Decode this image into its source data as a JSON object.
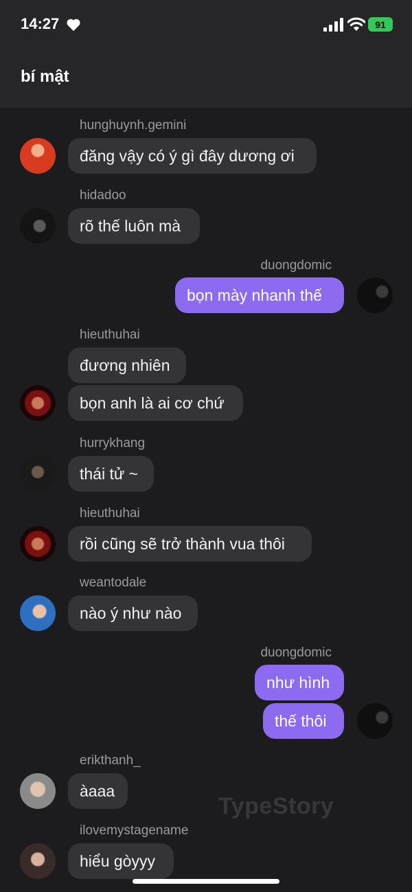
{
  "status": {
    "time": "14:27",
    "battery": "91"
  },
  "header": {
    "title": "bí mật"
  },
  "watermark": "TypeStory",
  "messages": [
    {
      "sender": "hunghuynh.gemini",
      "text": "đăng vậy có ý gì đây dương ơi"
    },
    {
      "sender": "hidadoo",
      "text": "rõ thế luôn mà"
    },
    {
      "sender": "duongdomic",
      "text": "bọn mày nhanh thế"
    },
    {
      "sender": "hieuthuhai",
      "text": "đương nhiên"
    },
    {
      "text": "bọn anh là ai cơ chứ"
    },
    {
      "sender": "hurrykhang",
      "text": "thái tử ~"
    },
    {
      "sender": "hieuthuhai",
      "text": "rồi cũng sẽ trở thành vua thôi"
    },
    {
      "sender": "weantodale",
      "text": "nào ý như nào"
    },
    {
      "sender": "duongdomic",
      "text": "như hình"
    },
    {
      "text": "thế thôi"
    },
    {
      "sender": "erikthanh_",
      "text": "àaaa"
    },
    {
      "sender": "ilovemystagename",
      "text": "hiểu gòyyy"
    }
  ],
  "colors": {
    "incoming": "#343436",
    "outgoing": "#8c6bf0",
    "background": "#1c1c1e"
  },
  "icons": [
    "heart-icon",
    "signal-icon",
    "wifi-icon",
    "battery-icon"
  ]
}
